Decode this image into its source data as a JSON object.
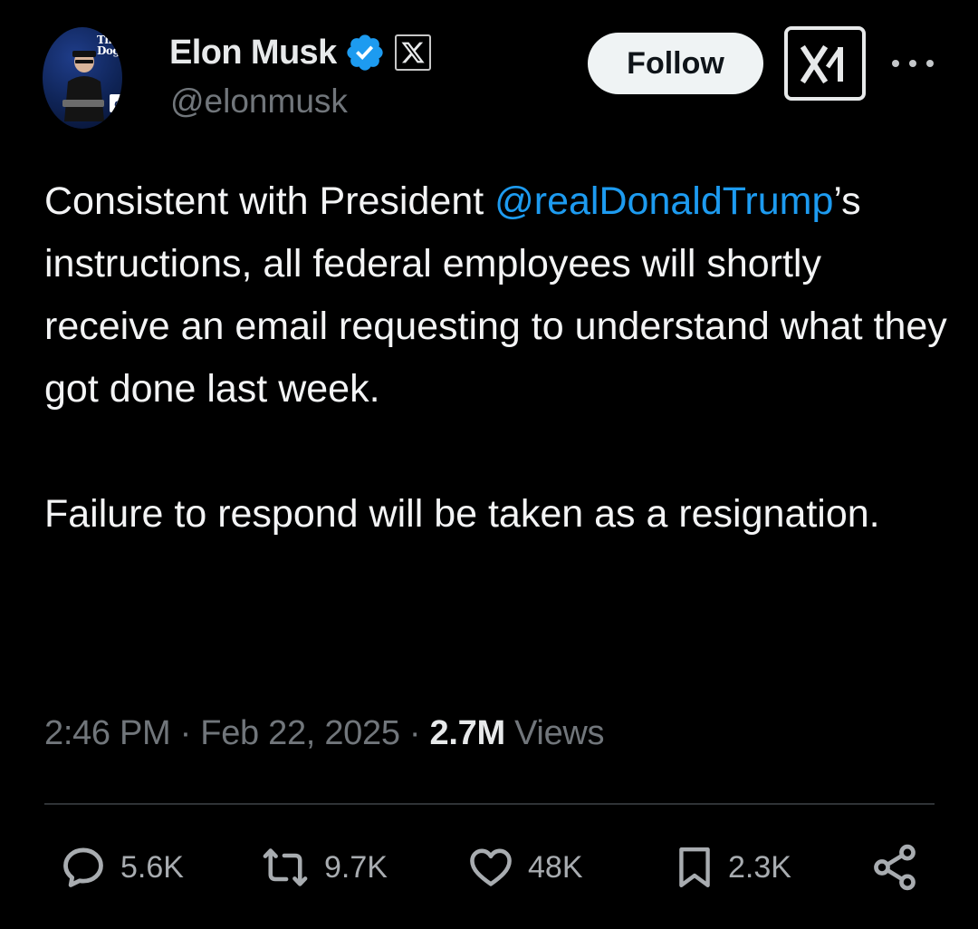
{
  "author": {
    "display_name": "Elon Musk",
    "handle": "@elonmusk",
    "avatar_text": "The Dogefa",
    "avatar_badge": "c"
  },
  "header": {
    "follow_label": "Follow"
  },
  "tweet": {
    "text_before_mention": "Consistent with President ",
    "mention": "@realDonaldTrump",
    "text_after_mention": "’s instructions, all federal employees will shortly receive an email requesting to understand what they got done last week.\n\nFailure to respond will be taken as a resignation."
  },
  "meta": {
    "time": "2:46 PM",
    "separator": " · ",
    "date": "Feb 22, 2025",
    "views_count": "2.7M",
    "views_label": "Views"
  },
  "actions": {
    "replies": "5.6K",
    "reposts": "9.7K",
    "likes": "48K",
    "bookmarks": "2.3K"
  },
  "icons": {
    "verified": "verified-badge-icon",
    "affiliate": "x-logo-icon",
    "xai": "xai-logo-icon",
    "more": "more-icon",
    "reply": "reply-icon",
    "repost": "repost-icon",
    "like": "heart-icon",
    "bookmark": "bookmark-icon",
    "share": "share-icon"
  },
  "colors": {
    "background": "#000000",
    "text": "#e7e9ea",
    "secondary_text": "#71767b",
    "link": "#1d9bf0",
    "verified": "#1d9bf0"
  }
}
